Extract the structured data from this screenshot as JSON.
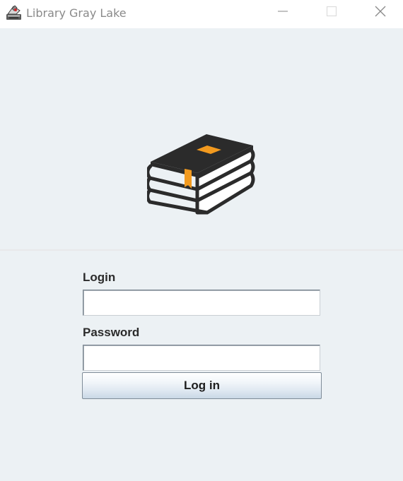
{
  "window": {
    "title": "Library Gray Lake",
    "icon": "library-app-icon",
    "controls": {
      "minimize_icon": "minimize-icon",
      "maximize_icon": "maximize-icon",
      "close_icon": "close-icon"
    }
  },
  "logo": {
    "icon": "stacked-books-icon",
    "colors": {
      "book": "#2b2b2b",
      "accent": "#f29a1f"
    }
  },
  "form": {
    "login_label": "Login",
    "login_value": "",
    "password_label": "Password",
    "password_value": "",
    "submit_label": "Log in"
  },
  "colors": {
    "background": "#ecf1f4",
    "titlebar": "#ffffff",
    "title_text": "#8a8a8a",
    "label_text": "#2b2b2b"
  }
}
